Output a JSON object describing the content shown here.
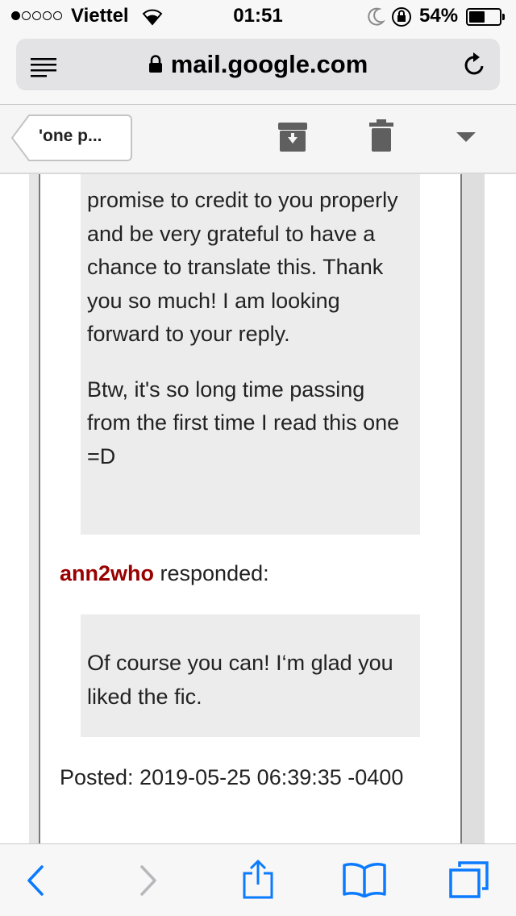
{
  "status_bar": {
    "carrier": "Viettel",
    "signal_bars_filled": 1,
    "signal_bars_total": 5,
    "time": "01:51",
    "battery_percent": "54%",
    "battery_level": 0.54
  },
  "browser": {
    "url": "mail.google.com",
    "reader_icon": "reader-icon",
    "reload_icon": "reload-icon"
  },
  "gmail_toolbar": {
    "back_label": "'one p...",
    "archive_icon": "archive-icon",
    "trash_icon": "trash-icon",
    "more_icon": "chevron-down-icon"
  },
  "message": {
    "quote_partial": "promise to credit to you properly and be very grateful to have a chance to translate this. Thank you so much! I am looking forward to your reply.",
    "quote_para2": "Btw, it's so long time passing from the first time I read this one =D",
    "responder": "ann2who",
    "responded_text": " responded:",
    "reply": "Of course you can! I‘m glad you liked the fic.",
    "posted": "Posted: 2019-05-25 06:39:35 -0400"
  },
  "bottom_bar": {
    "back_icon": "back-arrow-icon",
    "forward_icon": "forward-arrow-icon",
    "share_icon": "share-icon",
    "bookmarks_icon": "bookmarks-icon",
    "tabs_icon": "tabs-icon"
  },
  "colors": {
    "ios_blue": "#0a7aff",
    "responder_red": "#990000",
    "quote_bg": "#ececec"
  }
}
